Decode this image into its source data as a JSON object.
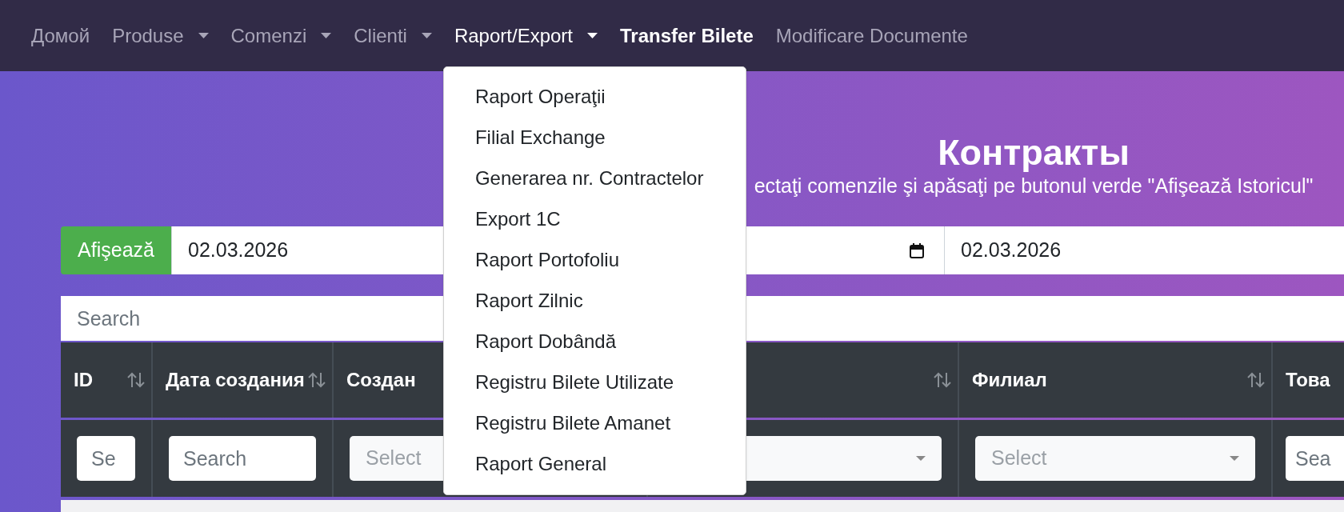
{
  "nav": {
    "items": [
      {
        "label": "Домой",
        "kind": "link",
        "selected": false
      },
      {
        "label": "Produse",
        "kind": "dropdown",
        "selected": false,
        "expanded": false
      },
      {
        "label": "Comenzi",
        "kind": "dropdown",
        "selected": false,
        "expanded": false
      },
      {
        "label": "Clienti",
        "kind": "dropdown",
        "selected": false,
        "expanded": false
      },
      {
        "label": "Raport/Export",
        "kind": "dropdown",
        "selected": false,
        "expanded": true,
        "menu": [
          "Raport Operaţii",
          "Filial Exchange",
          "Generarea nr. Contractelor",
          "Export 1C",
          "Raport Portofoliu",
          "Raport Zilnic",
          "Raport Dobândă",
          "Registru Bilete Utilizate",
          "Registru Bilete Amanet",
          "Raport General"
        ]
      },
      {
        "label": "Transfer Bilete",
        "kind": "link",
        "selected": true
      },
      {
        "label": "Modificare Documente",
        "kind": "link",
        "selected": false
      }
    ]
  },
  "header": {
    "title": "Контракты",
    "subtitle": "ectaţi comenzile şi apăsaţi pe butonul verde \"Afişează Istoricul\""
  },
  "date_filter": {
    "button": "Afişează",
    "fields": [
      {
        "value": "02.03.2026",
        "calendar_icon": true
      },
      {
        "value": "02.03.2026",
        "calendar_icon": false
      }
    ]
  },
  "search": {
    "placeholder": "Search"
  },
  "table": {
    "columns": [
      {
        "label": "ID",
        "sort": true,
        "filter": {
          "kind": "input",
          "placeholder": "Se"
        }
      },
      {
        "label": "Дата создания",
        "sort": true,
        "filter": {
          "kind": "input",
          "placeholder": "Search"
        }
      },
      {
        "label": "Создан",
        "sort": false,
        "filter": {
          "kind": "select",
          "placeholder": "Select"
        }
      },
      {
        "sort": true,
        "filter": {
          "kind": "select"
        }
      },
      {
        "label": "Филиал",
        "sort": true,
        "filter": {
          "kind": "select",
          "placeholder": "Select"
        }
      },
      {
        "label": "Това",
        "sort": false,
        "filter": {
          "kind": "input",
          "placeholder": "Sea"
        }
      }
    ]
  }
}
